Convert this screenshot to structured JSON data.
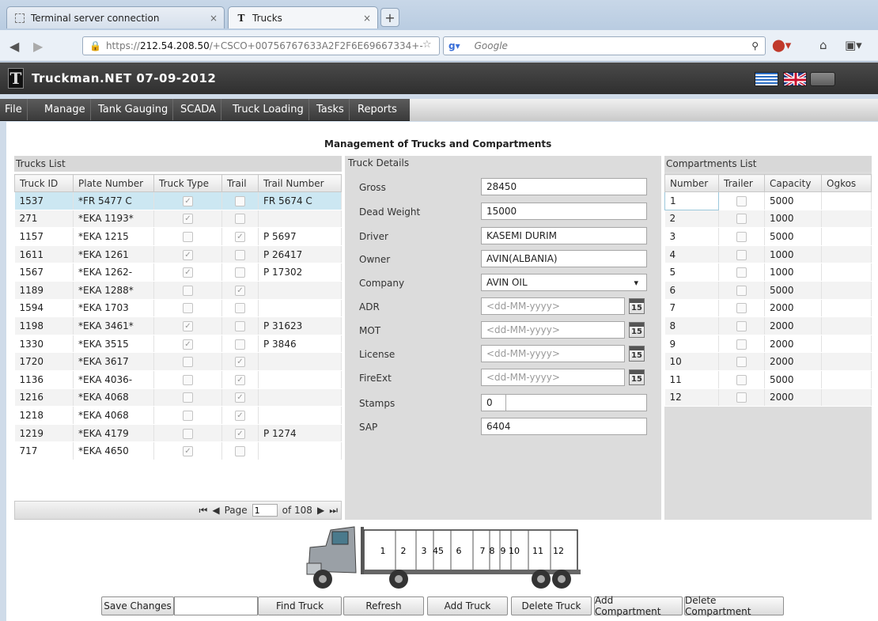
{
  "browser": {
    "tabs": [
      {
        "label": "Terminal server connection"
      },
      {
        "label": "Trucks"
      }
    ],
    "url_prefix": "https://",
    "url_host": "212.54.208.50",
    "url_rest": "/+CSCO+00756767633A2F2F6E69667334+-",
    "search_placeholder": "Google"
  },
  "app": {
    "title": "Truckman.NET  07-09-2012",
    "logo_letter": "T"
  },
  "menu": [
    "File",
    "Manage",
    "Tank Gauging",
    "SCADA",
    "Truck Loading",
    "Tasks",
    "Reports"
  ],
  "page_title": "Management of Trucks and Compartments",
  "trucks_list": {
    "header": "Trucks List",
    "columns": [
      "Truck ID",
      "Plate Number",
      "Truck Type",
      "Trail",
      "Trail Number"
    ],
    "rows": [
      {
        "id": "1537",
        "plate": "*FR 5477 C",
        "type": true,
        "trail": false,
        "trail_no": "FR 5674 C"
      },
      {
        "id": "271",
        "plate": "*EKA 1193*",
        "type": true,
        "trail": false,
        "trail_no": ""
      },
      {
        "id": "1157",
        "plate": "*EKA 1215",
        "type": false,
        "trail": true,
        "trail_no": "P  5697"
      },
      {
        "id": "1611",
        "plate": "*EKA 1261",
        "type": true,
        "trail": false,
        "trail_no": "P 26417"
      },
      {
        "id": "1567",
        "plate": "*EKA 1262-",
        "type": true,
        "trail": false,
        "trail_no": "P 17302"
      },
      {
        "id": "1189",
        "plate": "*EKA 1288*",
        "type": false,
        "trail": true,
        "trail_no": ""
      },
      {
        "id": "1594",
        "plate": "*EKA 1703",
        "type": false,
        "trail": false,
        "trail_no": ""
      },
      {
        "id": "1198",
        "plate": "*EKA 3461*",
        "type": true,
        "trail": false,
        "trail_no": "P 31623"
      },
      {
        "id": "1330",
        "plate": "*EKA 3515",
        "type": true,
        "trail": false,
        "trail_no": "P 3846"
      },
      {
        "id": "1720",
        "plate": "*EKA 3617",
        "type": false,
        "trail": true,
        "trail_no": ""
      },
      {
        "id": "1136",
        "plate": "*EKA 4036-",
        "type": false,
        "trail": true,
        "trail_no": ""
      },
      {
        "id": "1216",
        "plate": "*EKA 4068",
        "type": false,
        "trail": true,
        "trail_no": ""
      },
      {
        "id": "1218",
        "plate": "*EKA 4068",
        "type": false,
        "trail": true,
        "trail_no": ""
      },
      {
        "id": "1219",
        "plate": "*EKA 4179",
        "type": false,
        "trail": true,
        "trail_no": "P 1274"
      },
      {
        "id": "717",
        "plate": "*EKA 4650",
        "type": true,
        "trail": false,
        "trail_no": ""
      }
    ],
    "pager": {
      "page_label": "Page",
      "page": "1",
      "of_label": "of 108"
    }
  },
  "truck_details": {
    "header": "Truck Details",
    "fields": [
      {
        "label": "Gross",
        "value": "28450"
      },
      {
        "label": "Dead Weight",
        "value": "15000"
      },
      {
        "label": "Driver",
        "value": "KASEMI DURIM"
      },
      {
        "label": "Owner",
        "value": "AVIN(ALBANIA)"
      },
      {
        "label": "Company",
        "value": "AVIN OIL"
      },
      {
        "label": "ADR",
        "value": "<dd-MM-yyyy>"
      },
      {
        "label": "MOT",
        "value": "<dd-MM-yyyy>"
      },
      {
        "label": "License",
        "value": "<dd-MM-yyyy>"
      },
      {
        "label": "FireExt",
        "value": "<dd-MM-yyyy>"
      },
      {
        "label": "Stamps",
        "value": "0"
      },
      {
        "label": "SAP",
        "value": "6404"
      }
    ],
    "calendar_day": "15"
  },
  "compartments_list": {
    "header": "Compartments List",
    "columns": [
      "Number",
      "Trailer",
      "Capacity",
      "Ogkos"
    ],
    "rows": [
      {
        "num": "1",
        "cap": "5000"
      },
      {
        "num": "2",
        "cap": "1000"
      },
      {
        "num": "3",
        "cap": "5000"
      },
      {
        "num": "4",
        "cap": "1000"
      },
      {
        "num": "5",
        "cap": "1000"
      },
      {
        "num": "6",
        "cap": "5000"
      },
      {
        "num": "7",
        "cap": "2000"
      },
      {
        "num": "8",
        "cap": "2000"
      },
      {
        "num": "9",
        "cap": "2000"
      },
      {
        "num": "10",
        "cap": "2000"
      },
      {
        "num": "11",
        "cap": "5000"
      },
      {
        "num": "12",
        "cap": "2000"
      }
    ]
  },
  "truck_graphic_labels": [
    "1",
    "2",
    "3",
    "45",
    "6",
    "7",
    "8",
    "9",
    "10",
    "11",
    "12"
  ],
  "buttons": {
    "save": "Save Changes",
    "find": "Find Truck",
    "refresh": "Refresh",
    "add_truck": "Add Truck",
    "delete_truck": "Delete Truck",
    "add_comp": "Add Compartment",
    "delete_comp": "Delete Compartment"
  }
}
